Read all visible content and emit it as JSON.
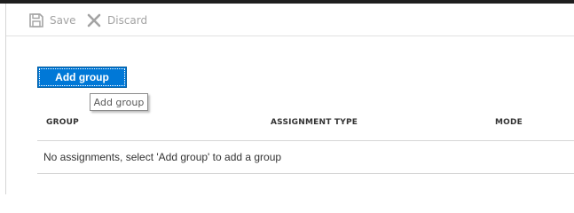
{
  "toolbar": {
    "save_label": "Save",
    "discard_label": "Discard",
    "save_icon": "floppy-disk-icon",
    "discard_icon": "close-x-icon"
  },
  "actions": {
    "add_group_label": "Add group",
    "tooltip": "Add group"
  },
  "table": {
    "columns": [
      "GROUP",
      "ASSIGNMENT TYPE",
      "MODE"
    ],
    "empty_message": "No assignments, select 'Add group' to add a group"
  },
  "colors": {
    "accent": "#0078d7",
    "disabled_text": "#a3a3a3"
  }
}
